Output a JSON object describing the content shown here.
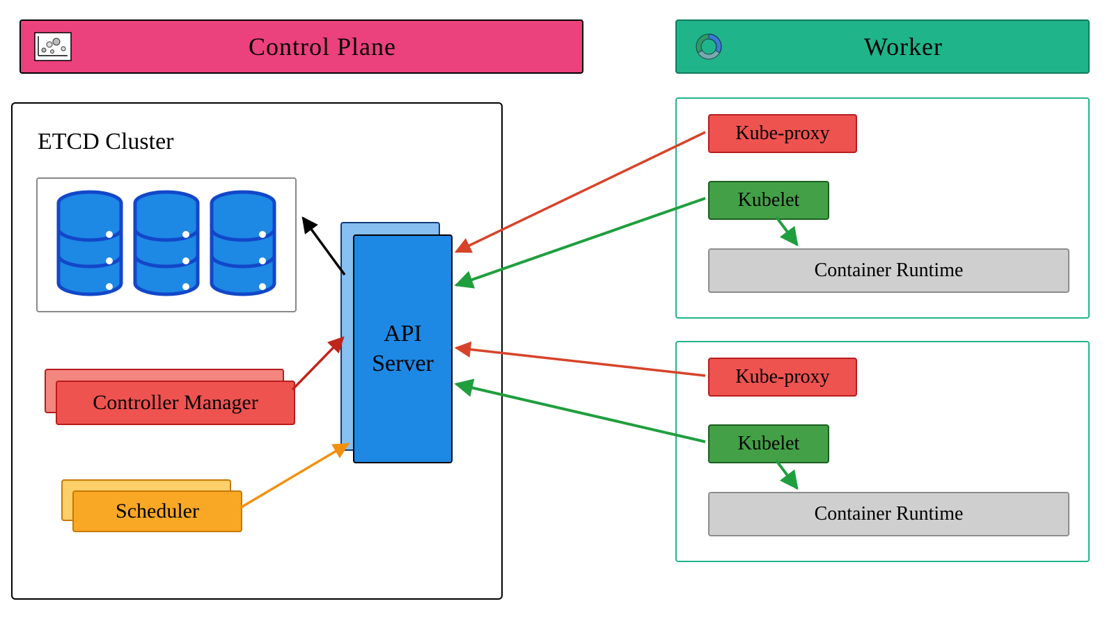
{
  "headers": {
    "control_plane": "Control Plane",
    "worker": "Worker"
  },
  "control_plane": {
    "etcd_label": "ETCD Cluster",
    "api_server_line1": "API",
    "api_server_line2": "Server",
    "controller_manager": "Controller Manager",
    "scheduler": "Scheduler"
  },
  "worker_node": {
    "kube_proxy": "Kube-proxy",
    "kubelet": "Kubelet",
    "container_runtime": "Container Runtime"
  },
  "colors": {
    "control_header": "#eb417c",
    "worker_header": "#1fb48a",
    "api_server": "#1e88e5",
    "controller_manager": "#ef5350",
    "scheduler": "#f9a825",
    "kube_proxy": "#ef5350",
    "kubelet": "#43a047",
    "container_runtime": "#cfcfcf",
    "etcd_db": "#1565e6",
    "arrow_red": "#d7432a",
    "arrow_green": "#1f9e3e",
    "arrow_orange": "#f2900d",
    "arrow_darkred": "#c0241a",
    "arrow_black": "#000000"
  }
}
